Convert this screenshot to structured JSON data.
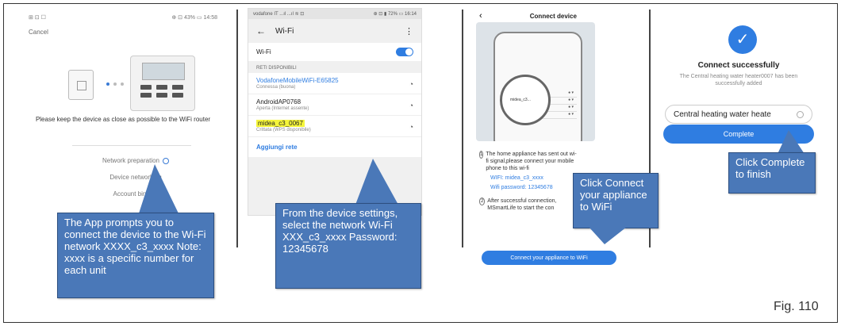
{
  "panel1": {
    "status_left": "⊞ ⊡ ☐",
    "status_right": "⊕ ⊡ 43% ▭ 14:58",
    "cancel": "Cancel",
    "instruction": "Please keep the device as close as possible to the WiFi router",
    "steps": [
      "Network preparation",
      "Device networking",
      "Account binding"
    ]
  },
  "callout1": "The App prompts you to connect the device to the Wi-Fi network XXXX_c3_xxxx Note: xxxx is a specific number for each unit",
  "panel2": {
    "status_left": "vodafone IT ...ıl ...ıl ≋ ⊡",
    "status_right": "⊕ ⊡ ▮ 72% ▭ 16:14",
    "title": "Wi-Fi",
    "wifi_label": "Wi-Fi",
    "networks_label": "RETI DISPONIBILI",
    "networks": [
      {
        "name": "VodafoneMobileWiFi-E65825",
        "desc": "Connessa (buona)",
        "highlight": false,
        "blue": true
      },
      {
        "name": "AndroidAP0768",
        "desc": "Aperta (Internet assente)",
        "highlight": false,
        "blue": false
      },
      {
        "name": "midea_c3_0067",
        "desc": "Crittata (WPS disponibile)",
        "highlight": true,
        "blue": false
      }
    ],
    "add_network": "Aggiungi rete"
  },
  "callout2": "From the device settings, select the network Wi-Fi XXX_c3_xxxx Password: 12345678",
  "panel3": {
    "title": "Connect device",
    "lens_text": "midea_c3...",
    "step1": "The home appliance has sent out wi-fi signal,please connect your mobile phone to this wi-fi",
    "wifi_line": "WIFI: midea_c3_xxxx",
    "password_line": "Wifi password: 12345678",
    "step2": "After successful connection, MSmartLife to start the con",
    "button": "Connect your appliance to WiFi"
  },
  "callout3": "Click Connect your appliance to WiFi",
  "panel4": {
    "title": "Connect successfully",
    "subtitle": "The Central heating water heater0007 has been successfully added",
    "device_name": "Central heating water heate",
    "button": "Complete"
  },
  "callout4": "Click Complete to finish",
  "figure_label": "Fig. 110"
}
